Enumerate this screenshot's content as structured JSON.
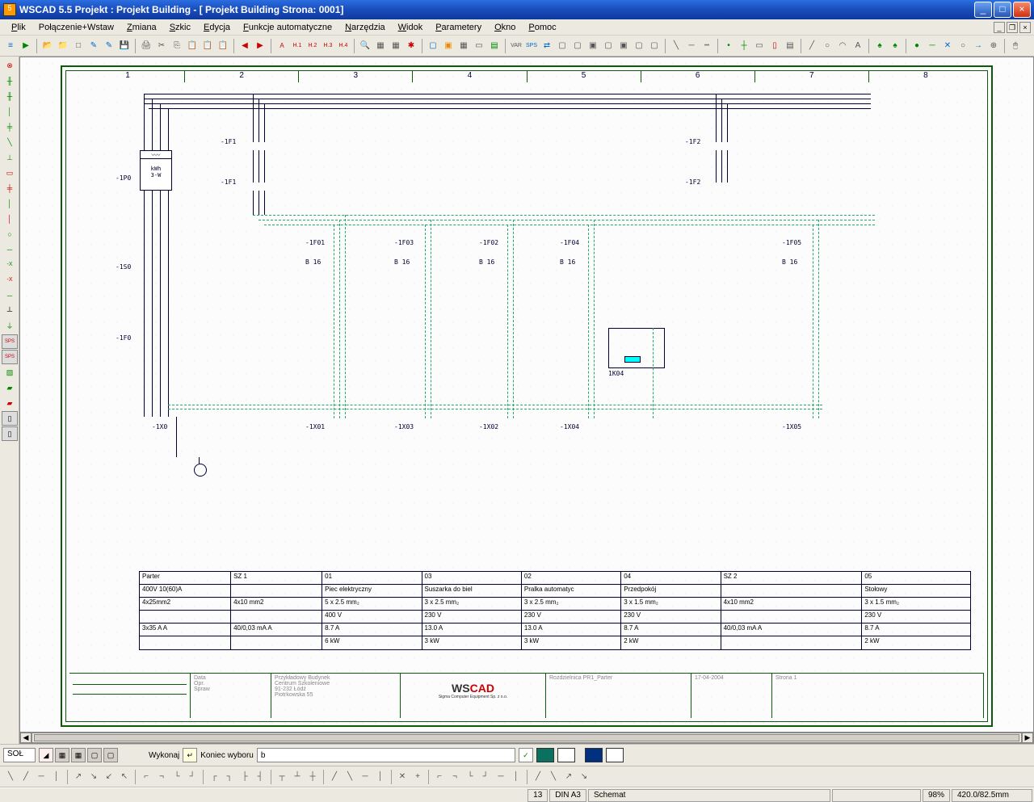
{
  "title": "WSCAD 5.5   Projekt : Projekt Building - [ Projekt Building Strona: 0001]",
  "menu": [
    "Plik",
    "Połączenie+Wstaw",
    "Zmiana",
    "Szkic",
    "Edycja",
    "Funkcje automatyczne",
    "Narzędzia",
    "Widok",
    "Parametery",
    "Okno",
    "Pomoc"
  ],
  "columns": [
    "1",
    "2",
    "3",
    "4",
    "5",
    "6",
    "7",
    "8"
  ],
  "labels": {
    "p0": "-1P0",
    "meter1": "kWh",
    "meter2": "3-W",
    "f1a": "-1F1",
    "f1b": "-1F1",
    "f2a": "-1F2",
    "f2b": "-1F2",
    "f01": "-1F01",
    "f02": "-1F02",
    "f03": "-1F03",
    "f04": "-1F04",
    "f05": "-1F05",
    "b16": "B 16",
    "q0": "-1S0",
    "f0": "-1F0",
    "k04": "1K04",
    "x0": "-1X0",
    "x01": "-1X01",
    "x02": "-1X02",
    "x03": "-1X03",
    "x04": "-1X04",
    "x05": "-1X05"
  },
  "table": {
    "cols_w": [
      100,
      100,
      100,
      100,
      100,
      100,
      150,
      100
    ],
    "rows": [
      [
        "Parter",
        "SZ 1",
        "01",
        "03",
        "02",
        "04",
        "SZ 2",
        "05"
      ],
      [
        "400V 10(60)A",
        "",
        "Piec elektryczny",
        "Suszarka do biel",
        "Pralka automatyc",
        "Przedpokój",
        "",
        "Stołowy"
      ],
      [
        "4x25mm2",
        "4x10 mm2",
        "5 x 2.5 mm₂",
        "3 x 2.5 mm₂",
        "3 x 2.5 mm₂",
        "3 x 1.5 mm₂",
        "4x10 mm2",
        "3 x 1.5 mm₂"
      ],
      [
        "",
        "",
        "400 V",
        "230 V",
        "230 V",
        "230 V",
        "",
        "230 V"
      ],
      [
        "3x35 A A",
        "40/0,03 mA A",
        "8.7 A",
        "13.0 A",
        "13.0 A",
        "8.7 A",
        "40/0,03 mA A",
        "8.7 A"
      ],
      [
        "",
        "",
        "6 kW",
        "3 kW",
        "3 kW",
        "2 kW",
        "",
        "2 kW"
      ]
    ]
  },
  "titleblock": {
    "c1": "Data",
    "c2": "17.04.2004",
    "c3": "Przykładowy Budynek",
    "c4": "Centrum Szkoleniowe",
    "c5": "91-232 Łódź",
    "c6": "Piotrkowska 55",
    "c7": "Rozdzielnica PR1_Parter",
    "c8": "17-04-2004",
    "c9": "Strona 1",
    "logo": "WS",
    "logo2": "CAD",
    "logosub": "Sigma Computer Equipment Sp. z o.o."
  },
  "cmdbar": {
    "layer": "SOŁ",
    "action1": "Wykonaj",
    "action2": "Koniec wyboru",
    "input": "b"
  },
  "status": {
    "page": "13",
    "fmt": "DIN A3",
    "mode": "Schemat",
    "zoom": "98%",
    "coords": "420.0/82.5mm"
  }
}
